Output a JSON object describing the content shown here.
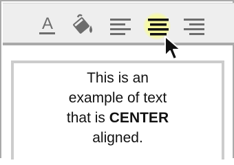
{
  "toolbar": {
    "tools": [
      {
        "name": "font-color",
        "icon": "text-color-icon",
        "label": "A",
        "active": false
      },
      {
        "name": "fill-color",
        "icon": "paint-bucket-icon",
        "active": false
      },
      {
        "name": "align-left",
        "icon": "align-left-icon",
        "active": false
      },
      {
        "name": "align-center",
        "icon": "align-center-icon",
        "active": true
      },
      {
        "name": "align-right",
        "icon": "align-right-icon",
        "active": false
      }
    ],
    "highlight_color": "#f7fa9e",
    "icon_color": "#6d6d6d",
    "active_icon_color": "#111111"
  },
  "document": {
    "line1": "This is an",
    "line2": "example of text",
    "line3_prefix": "that is ",
    "line3_bold": "CENTER",
    "line4": "aligned."
  },
  "cursor": {
    "icon": "mouse-pointer-icon"
  }
}
